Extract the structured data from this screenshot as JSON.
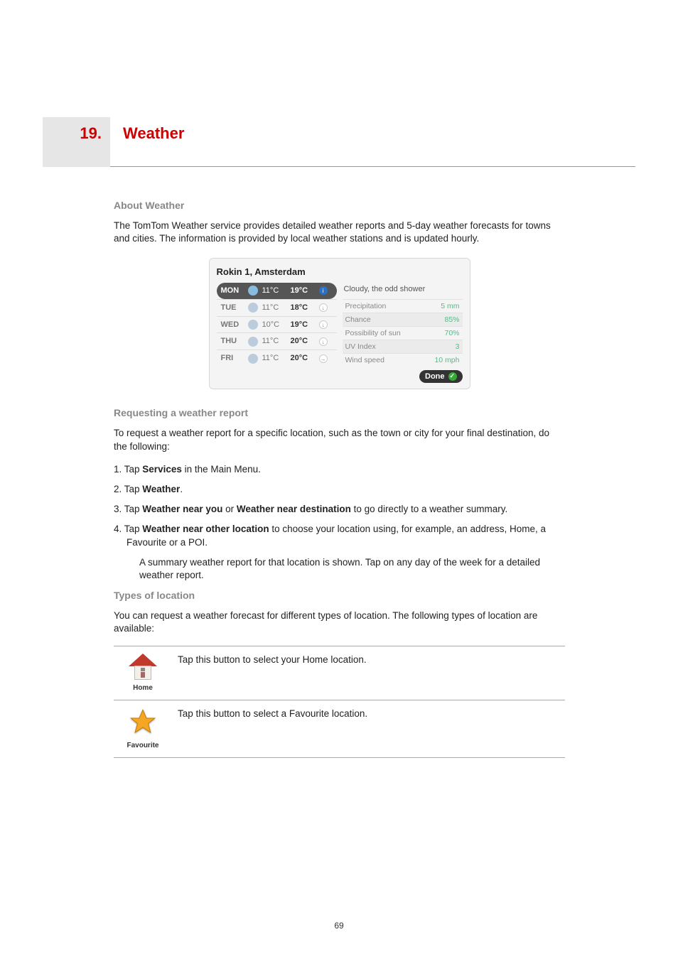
{
  "chapter": {
    "number": "19.",
    "title": "Weather"
  },
  "about": {
    "heading": "About Weather",
    "para": "The TomTom Weather service provides detailed weather reports and 5-day weather forecasts for towns and cities. The information is provided by local weather stations and is updated hourly."
  },
  "screenshot": {
    "title": "Rokin 1, Amsterdam",
    "days": [
      {
        "day": "MON",
        "lo": "11°C",
        "hi": "19°C",
        "selected": true
      },
      {
        "day": "TUE",
        "lo": "11°C",
        "hi": "18°C",
        "selected": false
      },
      {
        "day": "WED",
        "lo": "10°C",
        "hi": "19°C",
        "selected": false
      },
      {
        "day": "THU",
        "lo": "11°C",
        "hi": "20°C",
        "selected": false
      },
      {
        "day": "FRI",
        "lo": "11°C",
        "hi": "20°C",
        "selected": false
      }
    ],
    "summary": "Cloudy, the odd shower",
    "details": [
      {
        "label": "Precipitation",
        "value": "5 mm"
      },
      {
        "label": "Chance",
        "value": "85%"
      },
      {
        "label": "Possibility of sun",
        "value": "70%"
      },
      {
        "label": "UV Index",
        "value": "3"
      },
      {
        "label": "Wind speed",
        "value": "10 mph"
      }
    ],
    "done": "Done"
  },
  "request": {
    "heading": "Requesting a weather report",
    "intro": "To request a weather report for a specific location, such as the town or city for your final destination, do the following:",
    "steps": {
      "s1_a": "1. Tap ",
      "s1_b": "Services",
      "s1_c": " in the Main Menu.",
      "s2_a": "2. Tap ",
      "s2_b": "Weather",
      "s2_c": ".",
      "s3_a": "3. Tap ",
      "s3_b": "Weather near you",
      "s3_c": " or ",
      "s3_d": "Weather near destination",
      "s3_e": " to go directly to a weather summary.",
      "s4_a": "4. Tap ",
      "s4_b": "Weather near other location",
      "s4_c": " to choose your location using, for example, an address, Home, a Favourite or a POI.",
      "s4_sub": "A summary weather report for that location is shown. Tap on any day of the week for a detailed weather report."
    }
  },
  "types": {
    "heading": "Types of location",
    "intro": "You can request a weather forecast for different types of location. The following types of location are available:",
    "home": {
      "label": "Home",
      "desc": "Tap this button to select your Home location."
    },
    "favourite": {
      "label": "Favourite",
      "desc": "Tap this button to select a Favourite location."
    }
  },
  "page_number": "69"
}
